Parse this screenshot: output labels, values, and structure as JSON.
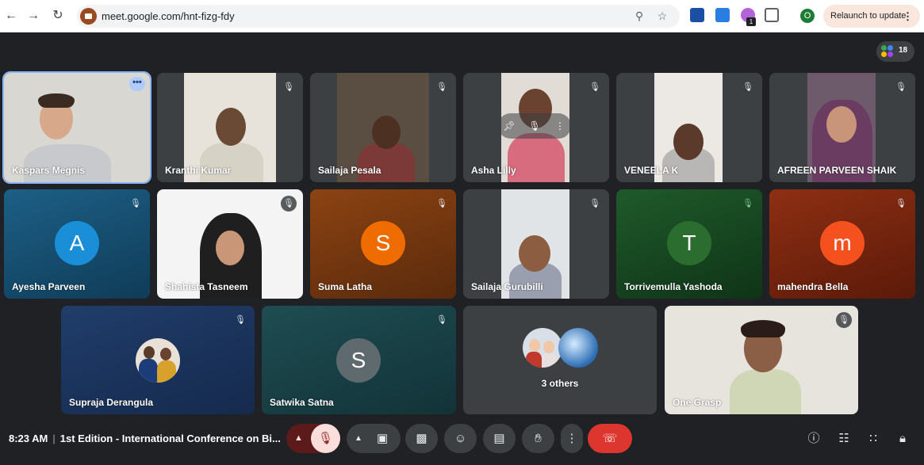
{
  "browser": {
    "url": "meet.google.com/hnt-fizg-fdy",
    "relaunch_label": "Relaunch to update",
    "profile_initial": "O",
    "extension_badge": "1"
  },
  "meeting": {
    "people_count": "18",
    "time": "8:23 AM",
    "separator": "|",
    "title": "1st Edition - International Conference on Bi..."
  },
  "participants": [
    {
      "name": "Kaspars Megnis",
      "type": "video",
      "muted": false
    },
    {
      "name": "Kranthi Kumar",
      "type": "video",
      "muted": true
    },
    {
      "name": "Sailaja Pesala",
      "type": "video",
      "muted": true
    },
    {
      "name": "Asha Lilly",
      "type": "video",
      "muted": true
    },
    {
      "name": "VENEELA K",
      "type": "video",
      "muted": true
    },
    {
      "name": "AFREEN PARVEEN SHAIK",
      "type": "video",
      "muted": true
    },
    {
      "name": "Ayesha Parveen",
      "type": "avatar",
      "initial": "A",
      "muted": true
    },
    {
      "name": "Shahista Tasneem",
      "type": "video",
      "muted": true
    },
    {
      "name": "Suma Latha",
      "type": "avatar",
      "initial": "S",
      "muted": true
    },
    {
      "name": "Sailaja Gurubilli",
      "type": "video",
      "muted": true
    },
    {
      "name": "Torrivemulla Yashoda",
      "type": "avatar",
      "initial": "T",
      "muted": true
    },
    {
      "name": "mahendra Bella",
      "type": "avatar",
      "initial": "m",
      "muted": true
    },
    {
      "name": "Supraja Derangula",
      "type": "photo",
      "muted": true
    },
    {
      "name": "Satwika Satna",
      "type": "avatar",
      "initial": "S",
      "muted": true
    },
    {
      "name": "One Grasp",
      "type": "video",
      "muted": true
    }
  ],
  "others_label": "3 others",
  "colors": {
    "accent": "#8ab4f8",
    "hangup": "#dc362e",
    "mic_muted_bg": "#f9dedc"
  }
}
